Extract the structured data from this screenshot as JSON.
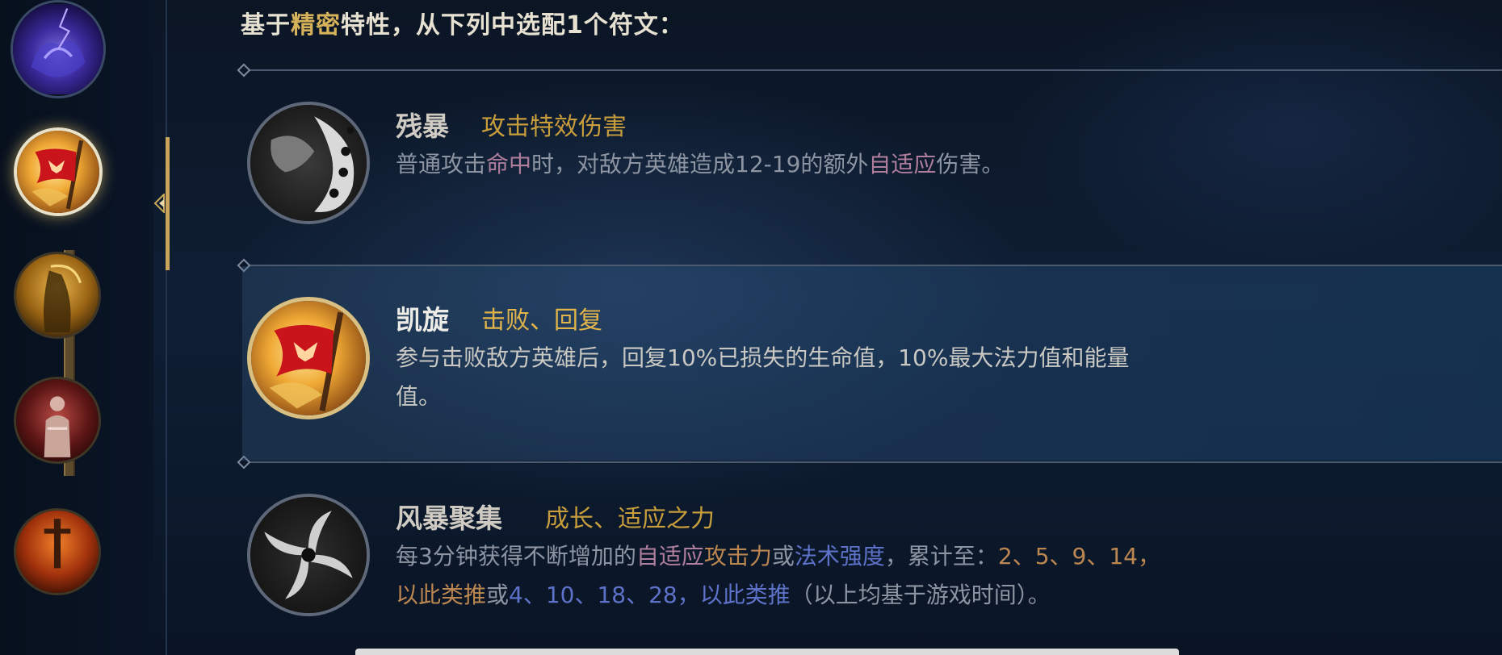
{
  "header": {
    "prefix": "基于",
    "highlight": "精密",
    "suffix": "特性，从下列中选配1个符文："
  },
  "sidebar": {
    "items": [
      {
        "icon": "dark-harvest-rune-icon",
        "selected": false
      },
      {
        "icon": "triumph-flag-icon",
        "selected": true
      },
      {
        "icon": "reaper-rune-icon",
        "selected": false
      },
      {
        "icon": "statue-rune-icon",
        "selected": false
      },
      {
        "icon": "sword-rune-icon",
        "selected": false
      }
    ]
  },
  "runes": [
    {
      "name": "残暴",
      "tag": "攻击特效伤害",
      "icon": "brutal-claw-icon",
      "selected": false,
      "desc": {
        "p1": "普通攻击",
        "k1": "命中",
        "p2": "时，对敌方英雄造成12-19的额外",
        "k2": "自适应",
        "p3": "伤害。"
      }
    },
    {
      "name": "凯旋",
      "tag": "击败、回复",
      "icon": "triumph-flag-icon",
      "selected": true,
      "desc": {
        "line1": "参与击败敌方英雄后，回复10%已损失的生命值，10%最大法力值和能量",
        "line2": "值。"
      }
    },
    {
      "name": "风暴聚集",
      "tag": "成长、适应之力",
      "icon": "storm-swirl-icon",
      "selected": false,
      "desc": {
        "p1": "每3分钟获得不断增加的",
        "k1": "自适应",
        "k2": "攻击力",
        "p2": "或",
        "k3": "法术强度",
        "p3": "，累计至：",
        "k4": "2、5、9、14，",
        "k5": "以此类推",
        "p4": "或",
        "k6": "4、10、18、28，以此类推",
        "p5": "（以上均基于游戏时间）。"
      }
    }
  ],
  "colors": {
    "accent_gold": "#c89d3b",
    "keyword_pink": "#b07e9d",
    "keyword_orange": "#bb8650",
    "keyword_blue": "#5d72c8"
  }
}
